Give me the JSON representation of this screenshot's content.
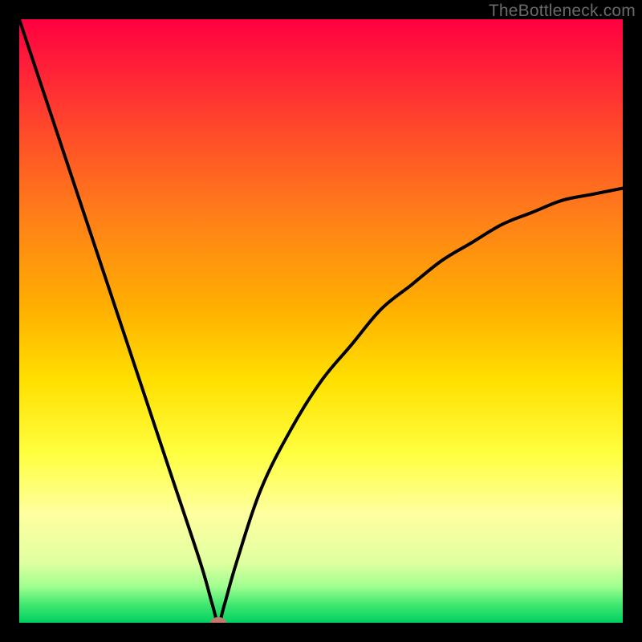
{
  "watermark": "TheBottleneck.com",
  "chart_data": {
    "type": "line",
    "title": "",
    "xlabel": "",
    "ylabel": "",
    "xlim": [
      0,
      100
    ],
    "ylim": [
      0,
      100
    ],
    "series": [
      {
        "name": "bottleneck-curve",
        "x": [
          0,
          5,
          10,
          15,
          20,
          25,
          30,
          32,
          33,
          34,
          36,
          40,
          45,
          50,
          55,
          60,
          65,
          70,
          75,
          80,
          85,
          90,
          95,
          100
        ],
        "values": [
          100,
          85,
          70,
          55,
          40,
          25,
          10,
          3,
          0,
          3,
          10,
          22,
          32,
          40,
          46,
          52,
          56,
          60,
          63,
          66,
          68,
          70,
          71,
          72
        ]
      }
    ],
    "marker": {
      "x": 33,
      "y": 0
    },
    "gradient_legend": {
      "top_color_meaning": "high-bottleneck",
      "bottom_color_meaning": "low-bottleneck",
      "colors": [
        "#ff0040",
        "#ff8018",
        "#ffe000",
        "#ffffa0",
        "#00d060"
      ]
    }
  }
}
